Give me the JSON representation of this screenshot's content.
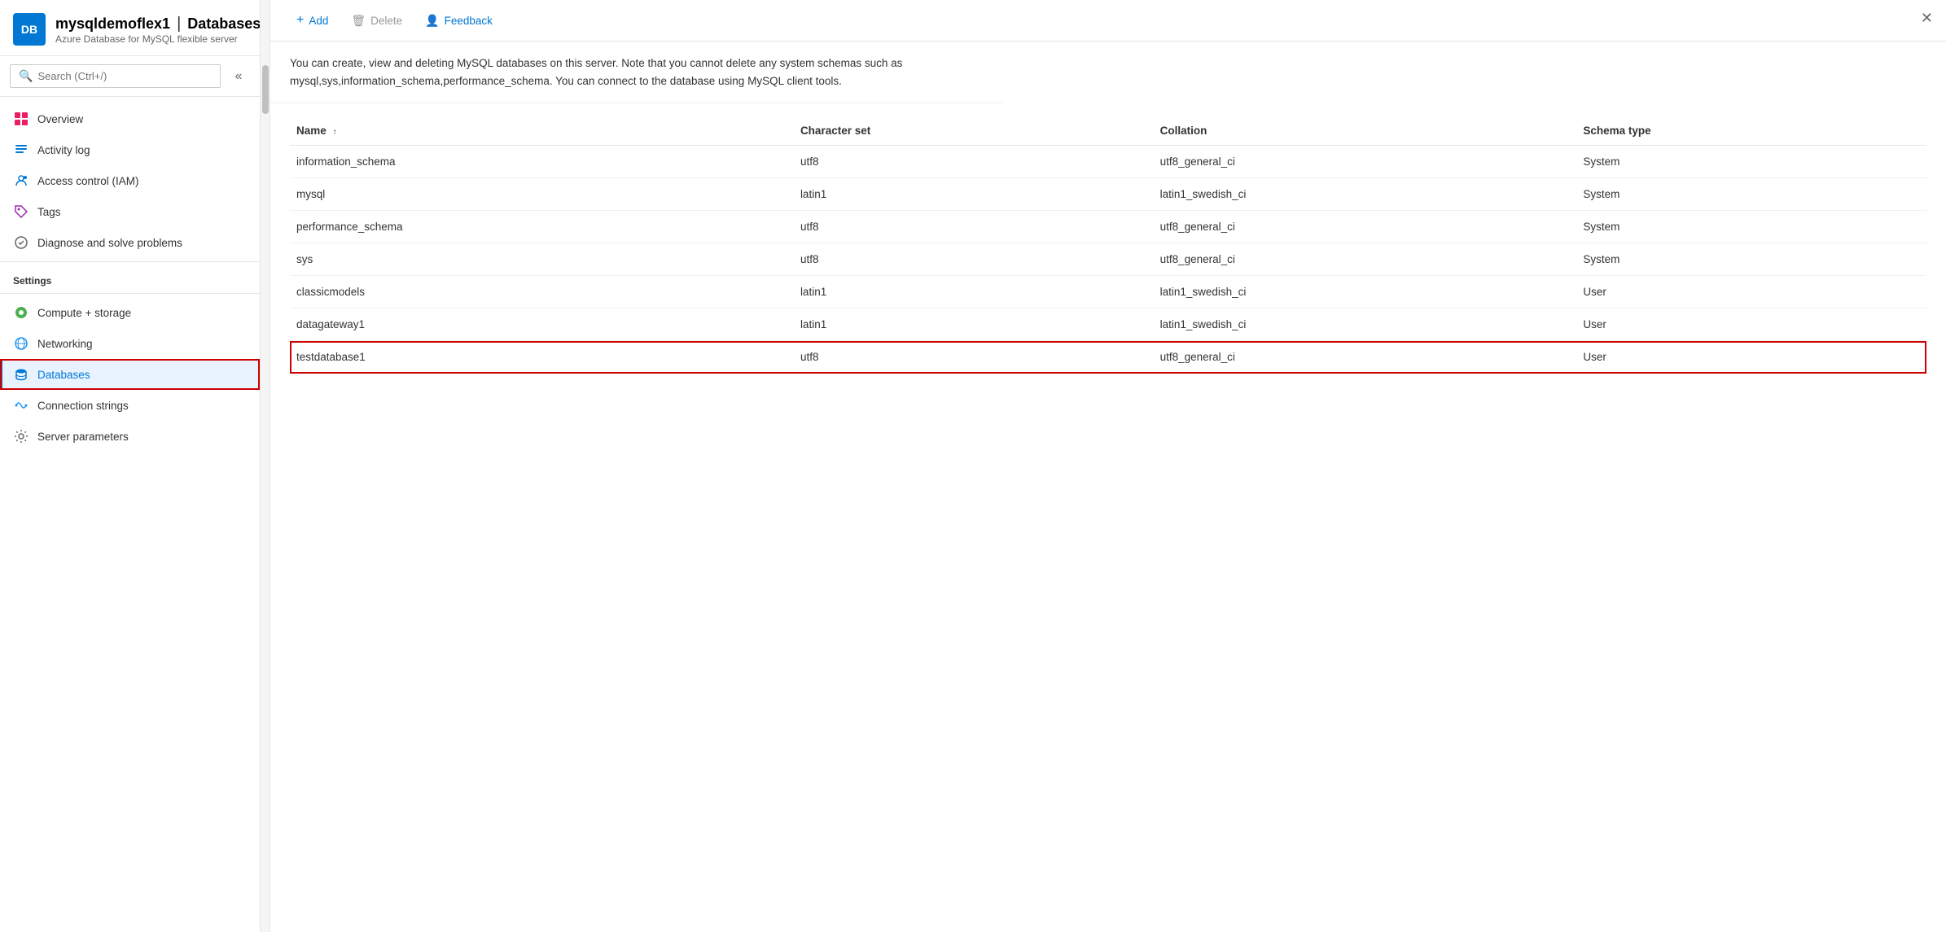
{
  "header": {
    "icon_text": "DB",
    "resource_name": "mysqldemoflex1",
    "page_name": "Databases",
    "subtitle": "Azure Database for MySQL flexible server",
    "more_options_label": "···",
    "close_label": "✕"
  },
  "search": {
    "placeholder": "Search (Ctrl+/)"
  },
  "collapse_btn": "«",
  "sidebar": {
    "nav_items": [
      {
        "id": "overview",
        "label": "Overview",
        "icon": "my-icon"
      },
      {
        "id": "activity-log",
        "label": "Activity log",
        "icon": "activity-icon"
      },
      {
        "id": "access-control",
        "label": "Access control (IAM)",
        "icon": "access-icon"
      },
      {
        "id": "tags",
        "label": "Tags",
        "icon": "tags-icon"
      },
      {
        "id": "diagnose",
        "label": "Diagnose and solve problems",
        "icon": "diagnose-icon"
      }
    ],
    "settings_label": "Settings",
    "settings_items": [
      {
        "id": "compute-storage",
        "label": "Compute + storage",
        "icon": "compute-icon"
      },
      {
        "id": "networking",
        "label": "Networking",
        "icon": "networking-icon"
      },
      {
        "id": "databases",
        "label": "Databases",
        "icon": "databases-icon",
        "active": true
      },
      {
        "id": "connection-strings",
        "label": "Connection strings",
        "icon": "connection-icon"
      },
      {
        "id": "server-parameters",
        "label": "Server parameters",
        "icon": "server-icon"
      }
    ]
  },
  "toolbar": {
    "add_label": "Add",
    "delete_label": "Delete",
    "feedback_label": "Feedback"
  },
  "description": "You can create, view and deleting MySQL databases on this server. Note that you cannot delete any system schemas such as mysql,sys,information_schema,performance_schema. You can connect to the database using MySQL client tools.",
  "table": {
    "columns": [
      {
        "label": "Name",
        "sort": "↑"
      },
      {
        "label": "Character set",
        "sort": ""
      },
      {
        "label": "Collation",
        "sort": ""
      },
      {
        "label": "Schema type",
        "sort": ""
      }
    ],
    "rows": [
      {
        "name": "information_schema",
        "character_set": "utf8",
        "collation": "utf8_general_ci",
        "schema_type": "System",
        "highlighted": false
      },
      {
        "name": "mysql",
        "character_set": "latin1",
        "collation": "latin1_swedish_ci",
        "schema_type": "System",
        "highlighted": false
      },
      {
        "name": "performance_schema",
        "character_set": "utf8",
        "collation": "utf8_general_ci",
        "schema_type": "System",
        "highlighted": false
      },
      {
        "name": "sys",
        "character_set": "utf8",
        "collation": "utf8_general_ci",
        "schema_type": "System",
        "highlighted": false
      },
      {
        "name": "classicmodels",
        "character_set": "latin1",
        "collation": "latin1_swedish_ci",
        "schema_type": "User",
        "highlighted": false
      },
      {
        "name": "datagateway1",
        "character_set": "latin1",
        "collation": "latin1_swedish_ci",
        "schema_type": "User",
        "highlighted": false
      },
      {
        "name": "testdatabase1",
        "character_set": "utf8",
        "collation": "utf8_general_ci",
        "schema_type": "User",
        "highlighted": true
      }
    ]
  }
}
